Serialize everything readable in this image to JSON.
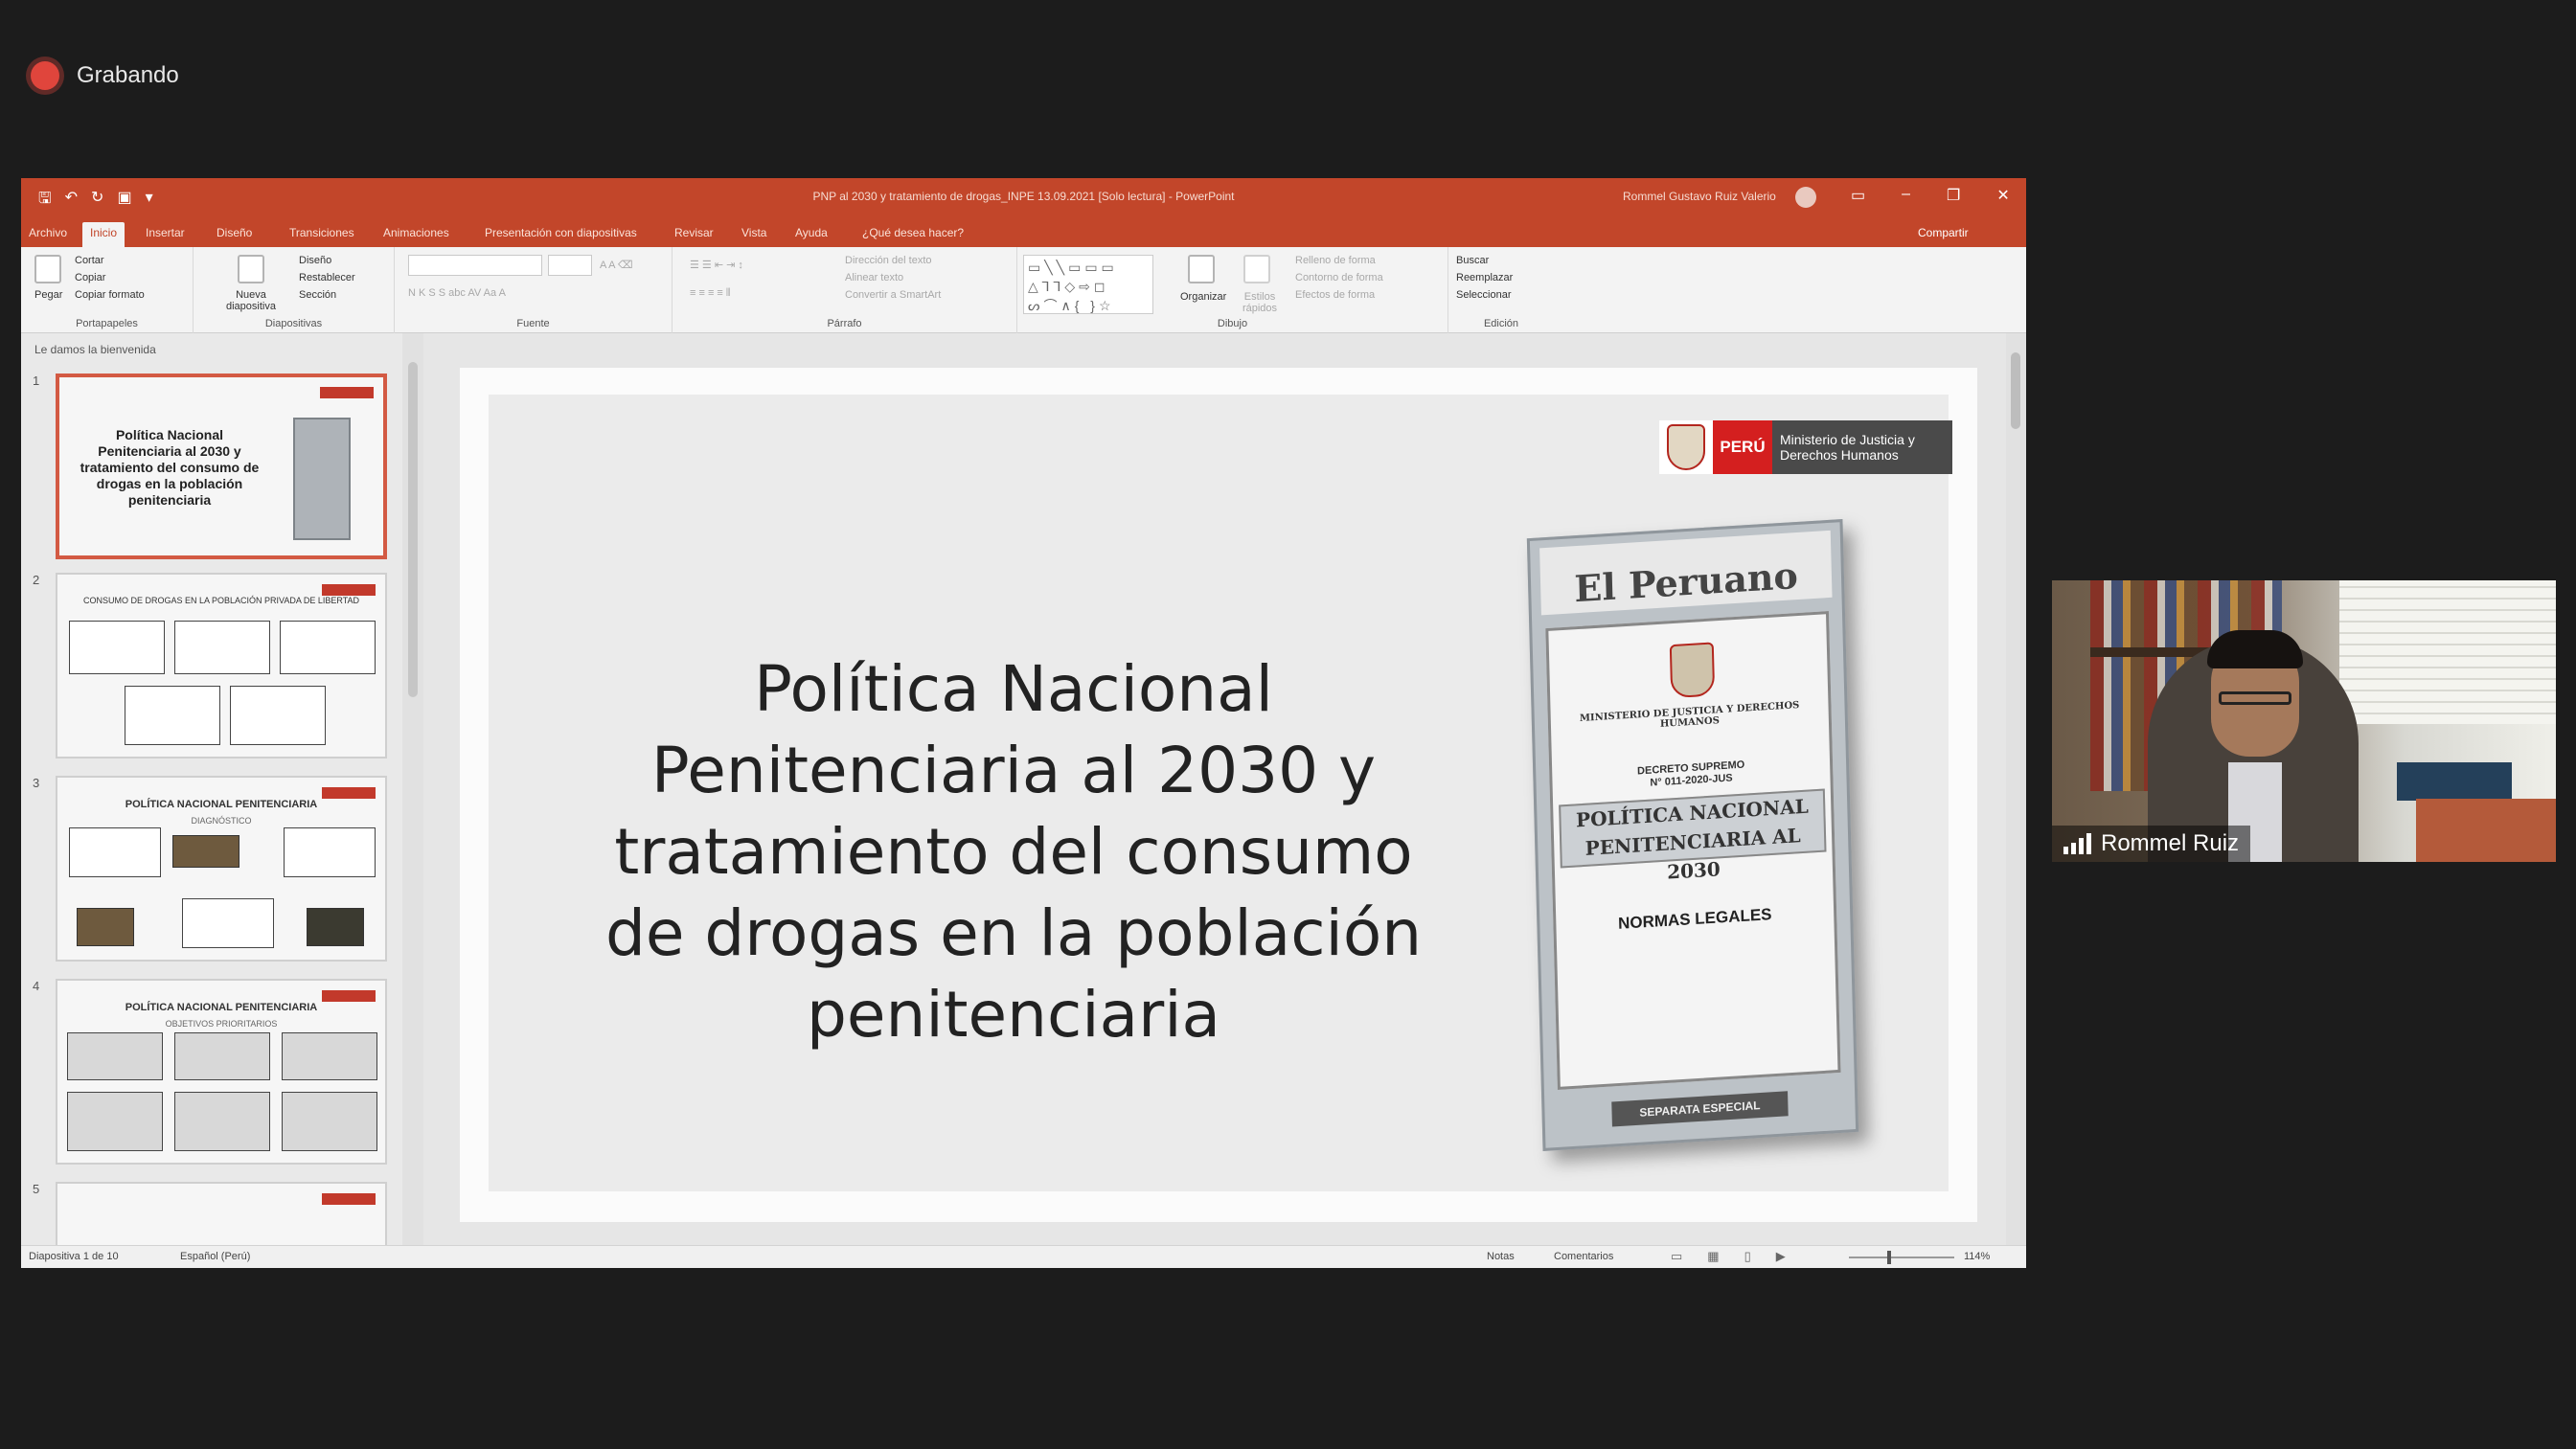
{
  "recording": {
    "label": "Grabando"
  },
  "window": {
    "title": "PNP al 2030 y tratamiento de drogas_INPE 13.09.2021 [Solo lectura] - PowerPoint",
    "user": "Rommel Gustavo Ruiz Valerio",
    "share": "Compartir"
  },
  "tabs": [
    "Archivo",
    "Inicio",
    "Insertar",
    "Diseño",
    "Transiciones",
    "Animaciones",
    "Presentación con diapositivas",
    "Revisar",
    "Vista",
    "Ayuda",
    "¿Qué desea hacer?"
  ],
  "ribbon": {
    "portapapeles": {
      "label": "Portapapeles",
      "paste": "Pegar",
      "cut": "Cortar",
      "copy": "Copiar",
      "format": "Copiar formato"
    },
    "diapositivas": {
      "label": "Diapositivas",
      "new": "Nueva diapositiva",
      "layout": "Diseño",
      "reset": "Restablecer",
      "section": "Sección"
    },
    "fuente": {
      "label": "Fuente",
      "buttons": "N  K  S  S  abc  AV  Aa  A"
    },
    "parrafo": {
      "label": "Párrafo",
      "dir": "Dirección del texto",
      "align": "Alinear texto",
      "smartart": "Convertir a SmartArt"
    },
    "dibujo": {
      "label": "Dibujo",
      "arrange": "Organizar",
      "styles": "Estilos rápidos",
      "fill": "Relleno de forma",
      "outline": "Contorno de forma",
      "effects": "Efectos de forma"
    },
    "edicion": {
      "label": "Edición",
      "find": "Buscar",
      "replace": "Reemplazar",
      "select": "Seleccionar"
    }
  },
  "thumbs": {
    "section": "Le damos la bienvenida",
    "slide1": {
      "num": "1",
      "text": "Política Nacional Penitenciaria al 2030 y tratamiento del consumo de drogas en la población penitenciaria"
    },
    "slide2": {
      "num": "2",
      "header": "CONSUMO DE DROGAS EN LA POBLACIÓN PRIVADA DE LIBERTAD"
    },
    "slide3": {
      "num": "3",
      "header": "POLÍTICA NACIONAL PENITENCIARIA",
      "sub": "DIAGNÓSTICO"
    },
    "slide4": {
      "num": "4",
      "header": "POLÍTICA NACIONAL PENITENCIARIA",
      "sub": "OBJETIVOS PRIORITARIOS"
    },
    "slide5": {
      "num": "5"
    }
  },
  "slide": {
    "title": "Política Nacional Penitenciaria al 2030 y tratamiento del consumo de drogas en la población penitenciaria",
    "logo_peru": "PERÚ",
    "logo_ministry": "Ministerio de Justicia y Derechos Humanos",
    "magazine": {
      "masthead": "El Peruano",
      "ministry": "MINISTERIO DE JUSTICIA Y DERECHOS HUMANOS",
      "decreto": "DECRETO SUPREMO",
      "decreto_num": "N° 011-2020-JUS",
      "policy": "POLÍTICA NACIONAL PENITENCIARIA AL 2030",
      "normas": "NORMAS LEGALES",
      "separata": "SEPARATA ESPECIAL"
    }
  },
  "status": {
    "slide_count": "Diapositiva 1 de 10",
    "language": "Español (Perú)",
    "notes": "Notas",
    "comments": "Comentarios",
    "zoom": "114%"
  },
  "webcam": {
    "name": "Rommel Ruiz"
  }
}
